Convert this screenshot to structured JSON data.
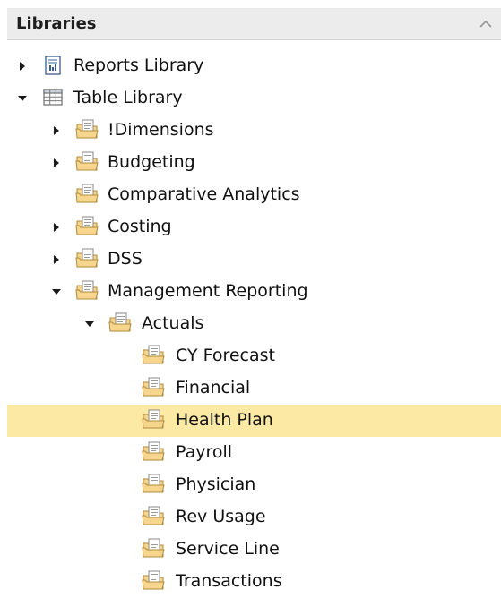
{
  "panel": {
    "title": "Libraries"
  },
  "tree": [
    {
      "label": "Reports Library",
      "icon": "report-icon",
      "level": 0,
      "state": "collapsed"
    },
    {
      "label": "Table Library",
      "icon": "table-icon",
      "level": 0,
      "state": "expanded"
    },
    {
      "label": "!Dimensions",
      "icon": "folder-icon",
      "level": 1,
      "state": "collapsed"
    },
    {
      "label": "Budgeting",
      "icon": "folder-icon",
      "level": 1,
      "state": "collapsed"
    },
    {
      "label": "Comparative Analytics",
      "icon": "folder-icon",
      "level": 1,
      "state": "leaf"
    },
    {
      "label": "Costing",
      "icon": "folder-icon",
      "level": 1,
      "state": "collapsed"
    },
    {
      "label": "DSS",
      "icon": "folder-icon",
      "level": 1,
      "state": "collapsed"
    },
    {
      "label": "Management Reporting",
      "icon": "folder-icon",
      "level": 1,
      "state": "expanded"
    },
    {
      "label": "Actuals",
      "icon": "folder-icon",
      "level": 2,
      "state": "expanded"
    },
    {
      "label": "CY Forecast",
      "icon": "folder-icon",
      "level": 3,
      "state": "leaf"
    },
    {
      "label": "Financial",
      "icon": "folder-icon",
      "level": 3,
      "state": "leaf"
    },
    {
      "label": "Health Plan",
      "icon": "folder-icon",
      "level": 3,
      "state": "leaf",
      "selected": true
    },
    {
      "label": "Payroll",
      "icon": "folder-icon",
      "level": 3,
      "state": "leaf"
    },
    {
      "label": "Physician",
      "icon": "folder-icon",
      "level": 3,
      "state": "leaf"
    },
    {
      "label": "Rev Usage",
      "icon": "folder-icon",
      "level": 3,
      "state": "leaf"
    },
    {
      "label": "Service Line",
      "icon": "folder-icon",
      "level": 3,
      "state": "leaf"
    },
    {
      "label": "Transactions",
      "icon": "folder-icon",
      "level": 3,
      "state": "leaf"
    }
  ],
  "colors": {
    "header_bg": "#ececec",
    "selection": "#fce9a3",
    "folder": "#f6d58c"
  }
}
